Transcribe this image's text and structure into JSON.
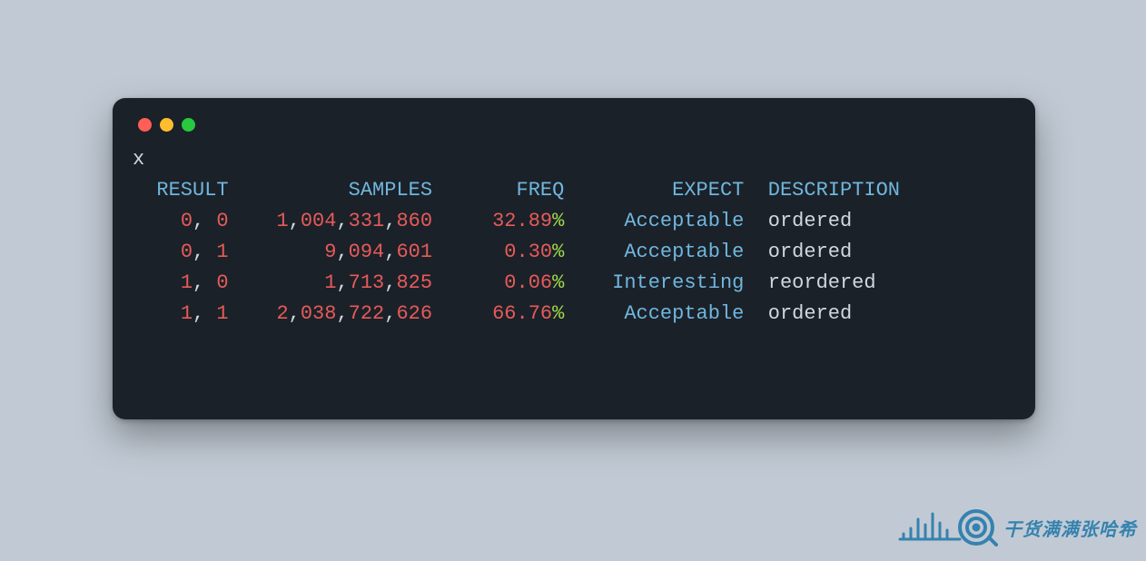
{
  "prompt": "x",
  "columns": {
    "result": "RESULT",
    "samples": "SAMPLES",
    "freq": "FREQ",
    "expect": "EXPECT",
    "description": "DESCRIPTION"
  },
  "rows": [
    {
      "result": [
        "0",
        "0"
      ],
      "samples": [
        "1",
        "004",
        "331",
        "860"
      ],
      "freq": "32.89",
      "expect": "Acceptable",
      "description": "ordered"
    },
    {
      "result": [
        "0",
        "1"
      ],
      "samples": [
        "9",
        "094",
        "601"
      ],
      "freq": "0.30",
      "expect": "Acceptable",
      "description": "ordered"
    },
    {
      "result": [
        "1",
        "0"
      ],
      "samples": [
        "1",
        "713",
        "825"
      ],
      "freq": "0.06",
      "expect": "Interesting",
      "description": "reordered"
    },
    {
      "result": [
        "1",
        "1"
      ],
      "samples": [
        "2",
        "038",
        "722",
        "626"
      ],
      "freq": "66.76",
      "expect": "Acceptable",
      "description": "ordered"
    }
  ],
  "colwidths": {
    "result": 8,
    "samples": 15,
    "freq": 9,
    "expect": 13
  },
  "watermark_text": "干货满满张哈希",
  "colors": {
    "bg_page": "#c1cad4",
    "bg_term": "#1b2128",
    "header": "#6fb6de",
    "digit": "#e65a5a",
    "percent": "#9fd84b",
    "text": "#cfd7de"
  }
}
